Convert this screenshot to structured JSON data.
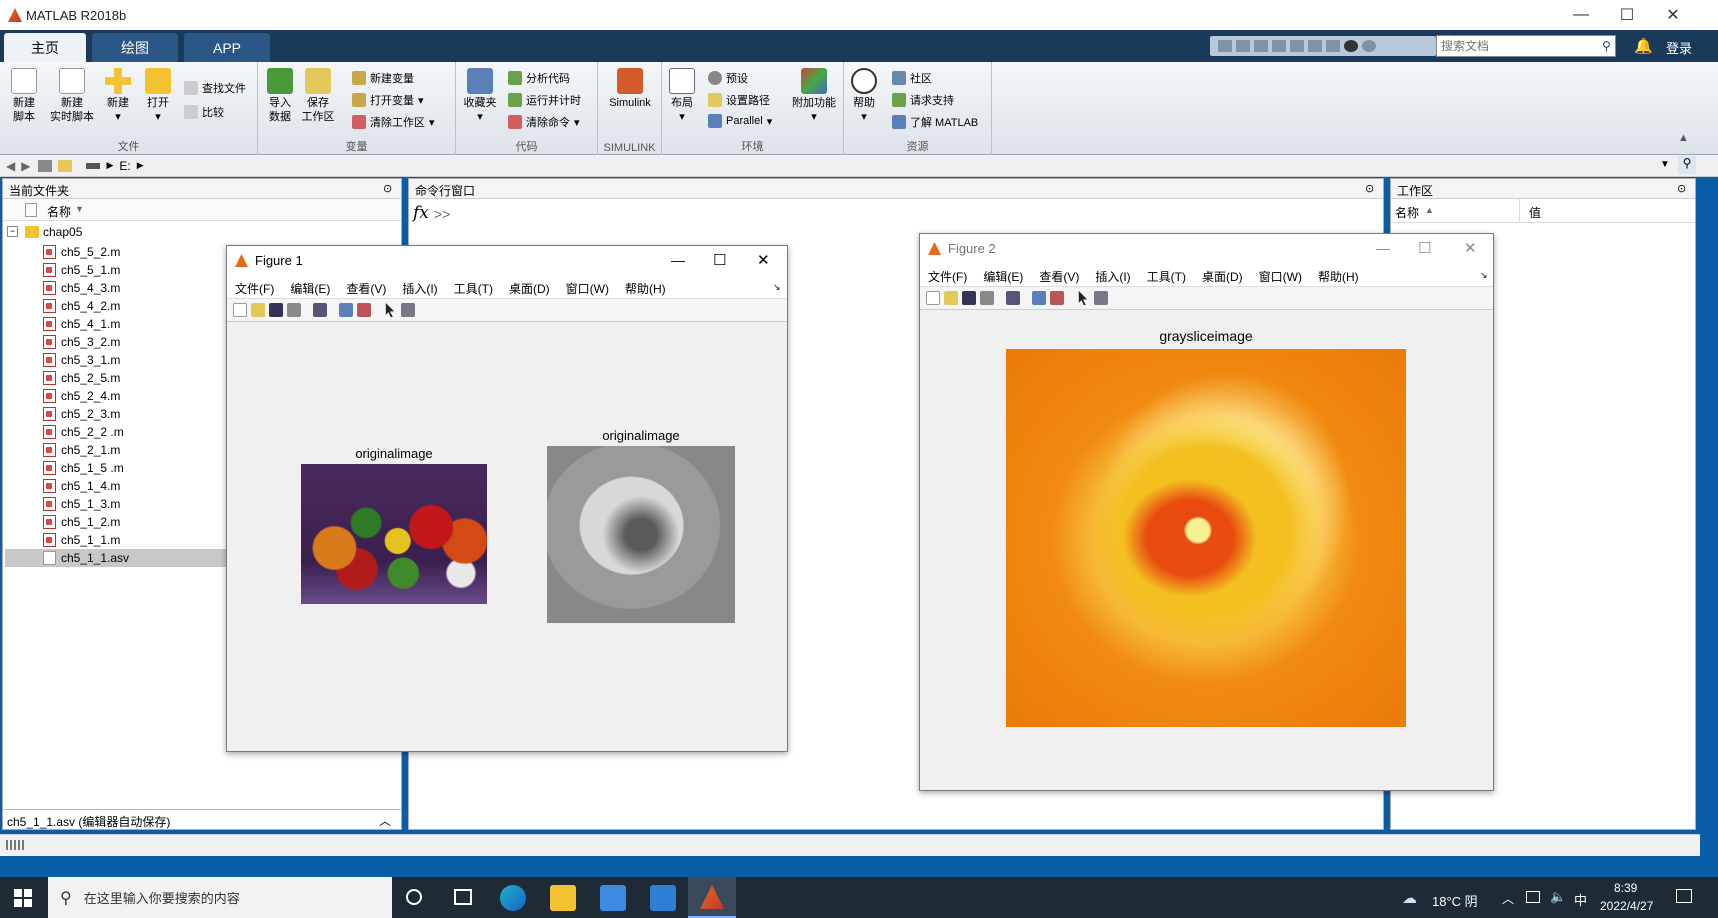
{
  "titlebar": {
    "title": "MATLAB R2018b"
  },
  "tabs": [
    {
      "label": "主页"
    },
    {
      "label": "绘图"
    },
    {
      "label": "APP"
    }
  ],
  "search": {
    "placeholder": "搜索文档",
    "login": "登录"
  },
  "ribbon": {
    "file": {
      "group": "文件",
      "new_script": "新建\n脚本",
      "new_live": "新建\n实时脚本",
      "new": "新建",
      "open": "打开",
      "find_files": "查找文件",
      "compare": "比较"
    },
    "variable": {
      "group": "变量",
      "import": "导入\n数据",
      "save_ws": "保存\n工作区",
      "new_var": "新建变量",
      "open_var": "打开变量",
      "clear_ws": "清除工作区"
    },
    "code": {
      "group": "代码",
      "favorites": "收藏夹",
      "analyze": "分析代码",
      "run_time": "运行并计时",
      "clear_cmd": "清除命令"
    },
    "simulink": {
      "group": "SIMULINK",
      "simulink": "Simulink"
    },
    "env": {
      "group": "环境",
      "layout": "布局",
      "prefs": "预设",
      "set_path": "设置路径",
      "parallel": "Parallel",
      "addons": "附加功能"
    },
    "resources": {
      "group": "资源",
      "help": "帮助",
      "community": "社区",
      "support": "请求支持",
      "learn": "了解 MATLAB"
    }
  },
  "address": {
    "path": "E:"
  },
  "current_folder": {
    "title": "当前文件夹",
    "col_name": "名称",
    "folder": "chap05",
    "files": [
      "ch5_5_2.m",
      "ch5_5_1.m",
      "ch5_4_3.m",
      "ch5_4_2.m",
      "ch5_4_1.m",
      "ch5_3_2.m",
      "ch5_3_1.m",
      "ch5_2_5.m",
      "ch5_2_4.m",
      "ch5_2_3.m",
      "ch5_2_2 .m",
      "ch5_2_1.m",
      "ch5_1_5 .m",
      "ch5_1_4.m",
      "ch5_1_3.m",
      "ch5_1_2.m",
      "ch5_1_1.m",
      "ch5_1_1.asv"
    ],
    "status": "ch5_1_1.asv  (编辑器自动保存)"
  },
  "command_window": {
    "title": "命令行窗口",
    "fx": "fx",
    "prompt": ">>"
  },
  "workspace": {
    "title": "工作区",
    "col_name": "名称",
    "col_value": "值"
  },
  "figure_menu": [
    "文件(F)",
    "编辑(E)",
    "查看(V)",
    "插入(I)",
    "工具(T)",
    "桌面(D)",
    "窗口(W)",
    "帮助(H)"
  ],
  "figure1": {
    "title": "Figure 1",
    "axes1_title": "originalimage",
    "axes2_title": "originalimage"
  },
  "figure2": {
    "title": "Figure 2",
    "axes_title": "graysliceimage"
  },
  "taskbar": {
    "search": "在这里输入你要搜索的内容",
    "weather": "18°C 阴",
    "ime": "中",
    "time": "8:39",
    "date": "2022/4/27"
  },
  "colors": {
    "accent": "#1a3a5c",
    "taskbar": "#1e2a36"
  }
}
